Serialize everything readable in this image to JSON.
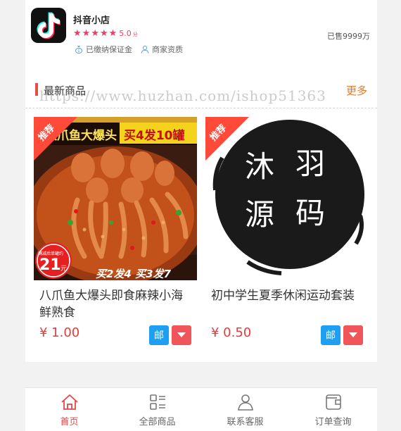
{
  "shop": {
    "name": "抖音小店",
    "rating": "5.0",
    "rating_unit": "分",
    "stars": 5,
    "sold": "已售9999万",
    "badges": [
      "已缴纳保证金",
      "商家资质"
    ]
  },
  "section": {
    "title": "最新商品",
    "more": "更多",
    "watermark": "https://www.huzhan.com/ishop51363"
  },
  "products": [
    {
      "title": "八爪鱼大爆头即食麻辣小海鲜熟食",
      "price": "¥ 1.00",
      "tag": "推荐",
      "mail_label": "邮",
      "image_banner": "八爪鱼大爆头",
      "image_promo": "买4发10罐",
      "image_price": "21",
      "image_price_unit": "元",
      "image_price_note": "满减后单罐约",
      "image_bottom": "买2发4 买3发7"
    },
    {
      "title": "初中学生夏季休闲运动套装",
      "price": "¥ 0.50",
      "tag": "推荐",
      "mail_label": "邮",
      "image_chars": [
        "沐",
        "羽",
        "源",
        "码"
      ]
    }
  ],
  "nav": [
    {
      "label": "首页",
      "icon": "home-icon",
      "active": true
    },
    {
      "label": "全部商品",
      "icon": "list-icon",
      "active": false
    },
    {
      "label": "联系客服",
      "icon": "user-icon",
      "active": false
    },
    {
      "label": "订单查询",
      "icon": "wallet-icon",
      "active": false
    }
  ],
  "colors": {
    "accent": "#e2474b",
    "star": "#f03c64",
    "price": "#e23c3c",
    "more": "#e27a2a",
    "mail": "#1e9ff2",
    "tag": "#ff4a3a"
  }
}
